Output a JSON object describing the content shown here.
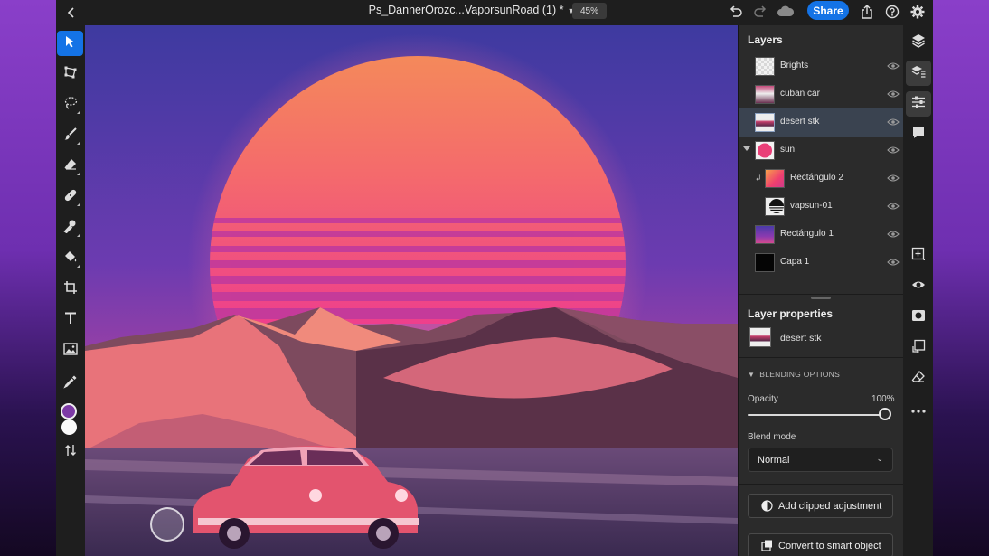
{
  "document": {
    "title": "Ps_DannerOrozc...VaporsunRoad (1) *",
    "zoom": "45%"
  },
  "topbar": {
    "share_label": "Share"
  },
  "tools": [
    {
      "name": "select-tool",
      "icon": "arrow-pointer-icon",
      "active": true
    },
    {
      "name": "transform-tool",
      "icon": "transform-icon"
    },
    {
      "name": "lasso-tool",
      "icon": "lasso-icon"
    },
    {
      "name": "brush-tool",
      "icon": "brush-icon"
    },
    {
      "name": "eraser-tool",
      "icon": "eraser-icon"
    },
    {
      "name": "healing-tool",
      "icon": "bandage-icon"
    },
    {
      "name": "clone-tool",
      "icon": "stamp-icon"
    },
    {
      "name": "fill-tool",
      "icon": "paint-bucket-icon"
    },
    {
      "name": "crop-tool",
      "icon": "crop-icon"
    },
    {
      "name": "type-tool",
      "icon": "text-icon"
    },
    {
      "name": "place-image-tool",
      "icon": "image-icon"
    },
    {
      "name": "eyedropper-tool",
      "icon": "eyedropper-icon"
    }
  ],
  "colors": {
    "foreground": "#7d3aa6",
    "background": "#fafafa",
    "accent": "#1473e6"
  },
  "layers_panel": {
    "title": "Layers",
    "layers": [
      {
        "name": "Brights"
      },
      {
        "name": "cuban car"
      },
      {
        "name": "desert stk",
        "selected": true
      },
      {
        "name": "sun",
        "group": true
      },
      {
        "name": "Rectángulo 2",
        "clipped": true
      },
      {
        "name": "vapsun-01",
        "clipped": true
      },
      {
        "name": "Rectángulo 1"
      },
      {
        "name": "Capa 1"
      }
    ]
  },
  "properties": {
    "title": "Layer properties",
    "layer_name": "desert stk",
    "blending_header": "BLENDING OPTIONS",
    "opacity_label": "Opacity",
    "opacity_value": "100%",
    "opacity_fraction": 1.0,
    "blend_mode_label": "Blend mode",
    "blend_mode_value": "Normal",
    "add_clipped_label": "Add clipped adjustment",
    "smart_object_label": "Convert to smart object"
  },
  "rail": [
    {
      "name": "layers-rail-button",
      "icon": "layers-stack-icon"
    },
    {
      "name": "layer-details-rail-button",
      "icon": "layers-details-icon",
      "active": true
    },
    {
      "name": "adjustments-rail-button",
      "icon": "sliders-icon",
      "active": true
    },
    {
      "name": "comments-rail-button",
      "icon": "comment-icon"
    },
    {
      "name": "add-layer-rail-button",
      "icon": "plus-square-icon"
    },
    {
      "name": "visibility-rail-button",
      "icon": "eye-icon"
    },
    {
      "name": "mask-rail-button",
      "icon": "mask-icon"
    },
    {
      "name": "clip-rail-button",
      "icon": "clip-icon"
    },
    {
      "name": "eraser-rail-button",
      "icon": "eraser-icon"
    },
    {
      "name": "more-rail-button",
      "icon": "more-dots-icon"
    }
  ]
}
